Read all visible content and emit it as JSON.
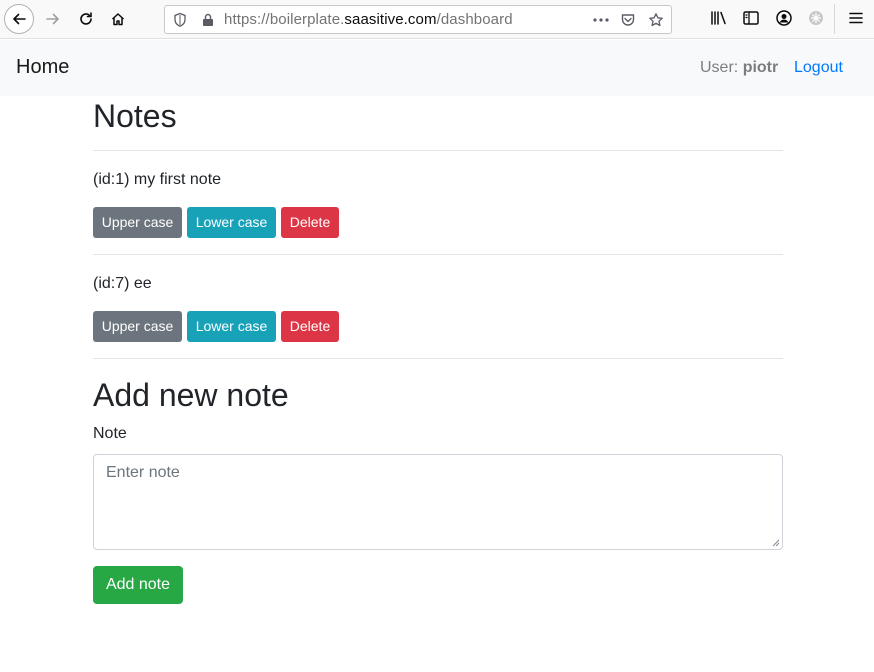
{
  "browser": {
    "url_prefix": "https://boilerplate.",
    "url_host": "saasitive.com",
    "url_path": "/dashboard"
  },
  "navbar": {
    "brand": "Home",
    "user_label": "User:",
    "username": "piotr",
    "logout": "Logout"
  },
  "page": {
    "title": "Notes",
    "notes": [
      {
        "text": "(id:1) my first note",
        "upper": "Upper case",
        "lower": "Lower case",
        "delete": "Delete"
      },
      {
        "text": "(id:7) ee",
        "upper": "Upper case",
        "lower": "Lower case",
        "delete": "Delete"
      }
    ],
    "add_section": {
      "title": "Add new note",
      "label": "Note",
      "placeholder": "Enter note",
      "submit": "Add note"
    }
  },
  "colors": {
    "secondary": "#6c757d",
    "info": "#17a2b8",
    "danger": "#dc3545",
    "success": "#28a745",
    "link": "#007bff"
  }
}
